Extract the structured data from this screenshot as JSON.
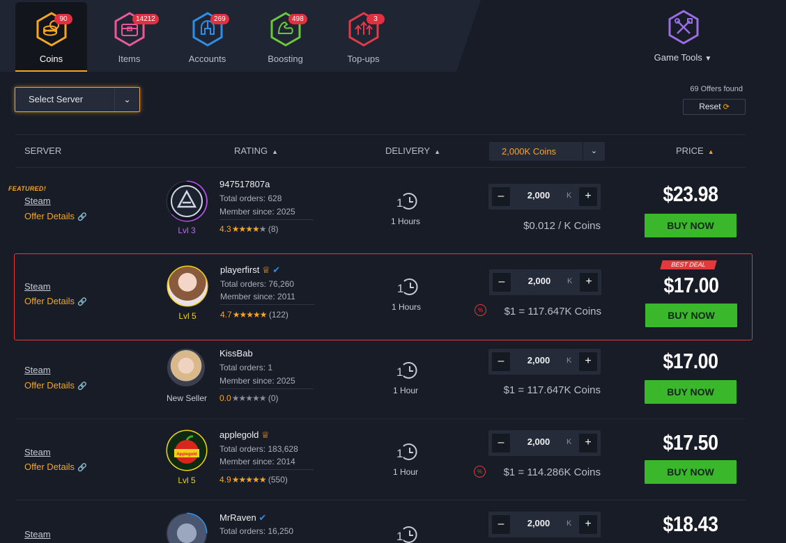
{
  "nav": {
    "tabs": [
      {
        "label": "Coins",
        "badge": "90",
        "icon": "coins-icon",
        "color": "#f5a623"
      },
      {
        "label": "Items",
        "badge": "14212",
        "icon": "chest-icon",
        "color": "#e85a9a"
      },
      {
        "label": "Accounts",
        "badge": "269",
        "icon": "helmet-icon",
        "color": "#2f8fe6"
      },
      {
        "label": "Boosting",
        "badge": "498",
        "icon": "flex-arm-icon",
        "color": "#6cc83a"
      },
      {
        "label": "Top-ups",
        "badge": "3",
        "icon": "arrows-up-icon",
        "color": "#e23a4a"
      }
    ],
    "tools": {
      "label": "Game Tools",
      "icon": "tools-icon",
      "color": "#9b6ee8"
    }
  },
  "filters": {
    "server_select": "Select Server",
    "offers_found": "69 Offers found",
    "reset": "Reset"
  },
  "table": {
    "headers": {
      "server": "SERVER",
      "rating": "RATING",
      "delivery": "DELIVERY",
      "price": "PRICE"
    },
    "amount_select": "2,000K Coins"
  },
  "offers": [
    {
      "featured_label": "FEATURED!",
      "server": "Steam",
      "details": "Offer Details",
      "seller": "947517807a",
      "orders": "Total orders: 628",
      "member": "Member since: 2025",
      "rating": "4.3",
      "stars": 4.3,
      "reviews": "(8)",
      "level": "Lvl 3",
      "delivery": "1 Hours",
      "qty": "2,000",
      "unit": "K",
      "rate": "$0.012 / K Coins",
      "price": "$23.98",
      "buy": "BUY NOW"
    },
    {
      "badge": "BEST DEAL",
      "server": "Steam",
      "details": "Offer Details",
      "seller": "playerfirst",
      "orders": "Total orders: 76,260",
      "member": "Member since: 2011",
      "rating": "4.7",
      "stars": 4.7,
      "reviews": "(122)",
      "level": "Lvl 5",
      "delivery": "1 Hours",
      "qty": "2,000",
      "unit": "K",
      "rate": "$1 = 117.647K Coins",
      "price": "$17.00",
      "buy": "BUY NOW"
    },
    {
      "server": "Steam",
      "details": "Offer Details",
      "seller": "KissBab",
      "orders": "Total orders: 1",
      "member": "Member since: 2025",
      "rating": "0.0",
      "stars": 0,
      "reviews": "(0)",
      "level": "New Seller",
      "delivery": "1 Hour",
      "qty": "2,000",
      "unit": "K",
      "rate": "$1 = 117.647K Coins",
      "price": "$17.00",
      "buy": "BUY NOW"
    },
    {
      "server": "Steam",
      "details": "Offer Details",
      "seller": "applegold",
      "orders": "Total orders: 183,628",
      "member": "Member since: 2014",
      "rating": "4.9",
      "stars": 4.9,
      "reviews": "(550)",
      "level": "Lvl 5",
      "delivery": "1 Hour",
      "qty": "2,000",
      "unit": "K",
      "rate": "$1 = 114.286K Coins",
      "price": "$17.50",
      "buy": "BUY NOW",
      "avatar_text": "Applegold Safeandfast"
    },
    {
      "server": "Steam",
      "seller": "MrRaven",
      "orders": "Total orders: 16,250",
      "qty": "2,000",
      "unit": "K",
      "price": "$18.43"
    }
  ],
  "colors": {
    "accent": "#f5a623",
    "buy": "#3ab72a",
    "danger": "#e23a3a"
  }
}
